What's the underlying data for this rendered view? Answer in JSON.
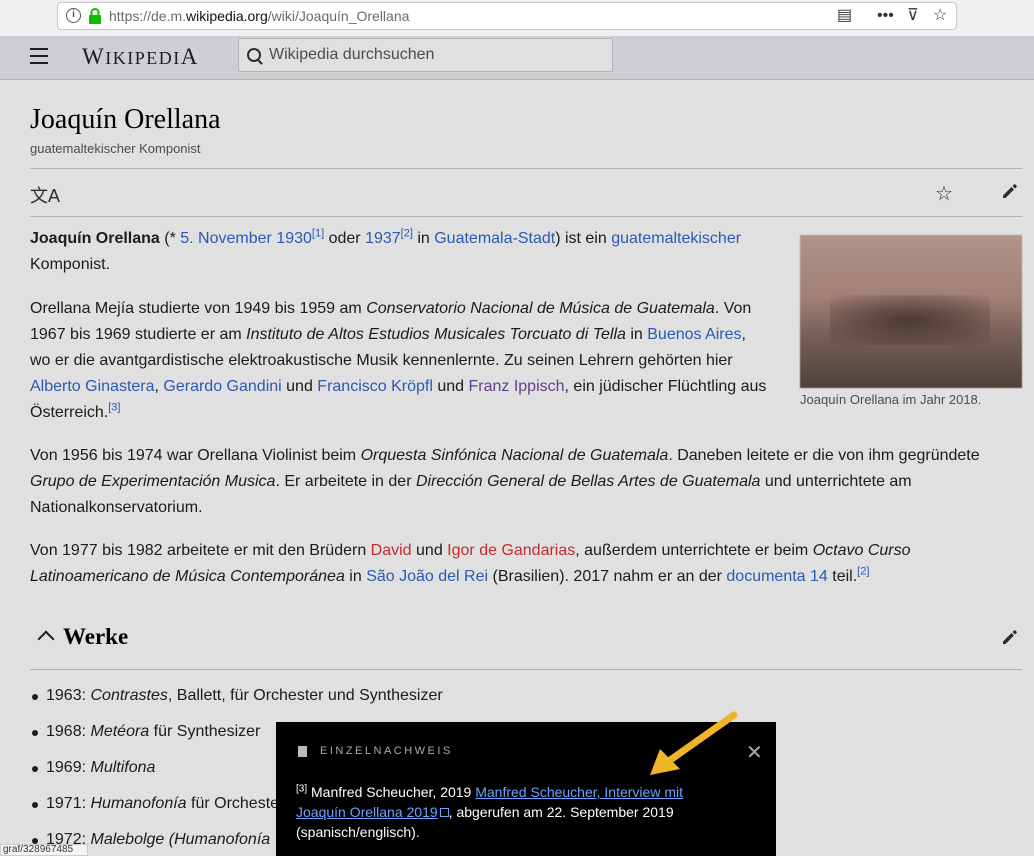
{
  "browser": {
    "url_prefix": "https://de.m.",
    "url_domain": "wikipedia.org",
    "url_path": "/wiki/Joaquín_Orellana"
  },
  "header": {
    "logo": "Wikipedia",
    "search_placeholder": "Wikipedia durchsuchen"
  },
  "article": {
    "title": "Joaquín Orellana",
    "subtitle": "guatemaltekischer Komponist",
    "image_caption": "Joaquín Orellana im Jahr 2018.",
    "section_title": "Werke",
    "works": [
      {
        "year": "1963:",
        "title": "Contrastes",
        "rest": ", Ballett, für Orchester und Synthesizer"
      },
      {
        "year": "1968:",
        "title": "Metéora",
        "rest": " für Synthesizer"
      },
      {
        "year": "1969:",
        "title": "Multifona",
        "rest": ""
      },
      {
        "year": "1971:",
        "title": "Humanofonía",
        "rest": " für Orcheste"
      },
      {
        "year": "1972:",
        "title": "Malebolge (Humanofonía",
        "rest": ""
      }
    ]
  },
  "reference": {
    "header": "EINZELNACHWEIS",
    "number": "[3]",
    "prefix": " Manfred Scheucher, 2019 ",
    "link": "Manfred Scheucher, Interview mit Joaquín Orellana 2019",
    "suffix": ", abgerufen am 22. September 2019 (spanisch/englisch)."
  },
  "status_bar": "graf/328967485",
  "colors": {
    "link": "#3366cc",
    "visited": "#6b4ba1",
    "redlink": "#d33",
    "arrow": "#f0b429"
  }
}
